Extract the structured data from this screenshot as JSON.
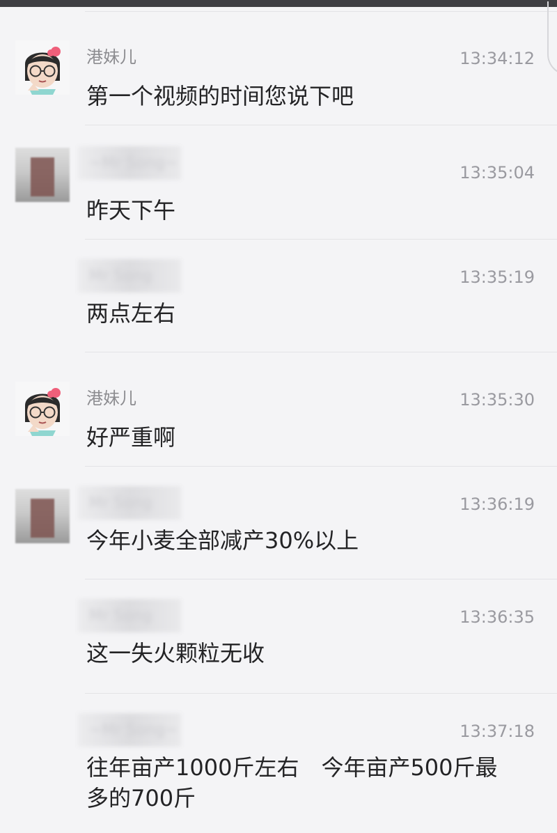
{
  "messages": [
    {
      "sender": "港妹儿",
      "time": "13:34:12",
      "text": "第一个视频的时间您说下吧",
      "avatar": "cartoon-girl"
    },
    {
      "sender": "",
      "time": "13:35:04",
      "text": "昨天下午",
      "avatar": "blurred-photo"
    },
    {
      "sender": "",
      "time": "13:35:19",
      "text": "两点左右",
      "avatar": ""
    },
    {
      "sender": "港妹儿",
      "time": "13:35:30",
      "text": "好严重啊",
      "avatar": "cartoon-girl"
    },
    {
      "sender": "",
      "time": "13:36:19",
      "text": "今年小麦全部减产30%以上",
      "avatar": "blurred-photo"
    },
    {
      "sender": "",
      "time": "13:36:35",
      "text": "这一失火颗粒无收",
      "avatar": ""
    },
    {
      "sender": "",
      "time": "13:37:18",
      "text": "往年亩产1000斤左右　今年亩产500斤最多的700斤",
      "avatar": ""
    }
  ]
}
